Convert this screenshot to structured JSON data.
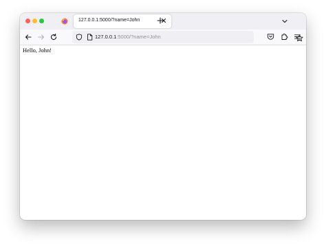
{
  "window": {
    "traffic_lights": {
      "close_color": "#fe5f57",
      "minimize_color": "#febc2e",
      "maximize_color": "#28c840"
    }
  },
  "tab": {
    "title": "127.0.0.1:5000/?name=John",
    "favicon": "firefox-icon"
  },
  "toolbar": {
    "icons": [
      "back-arrow-icon",
      "forward-arrow-icon",
      "reload-icon",
      "shield-icon",
      "page-icon",
      "star-icon",
      "pocket-icon",
      "extensions-icon",
      "menu-icon"
    ]
  },
  "urlbar": {
    "host": "127.0.0.1",
    "rest": ":5000/?name=John"
  },
  "page": {
    "greeting": "Hello, John!"
  }
}
